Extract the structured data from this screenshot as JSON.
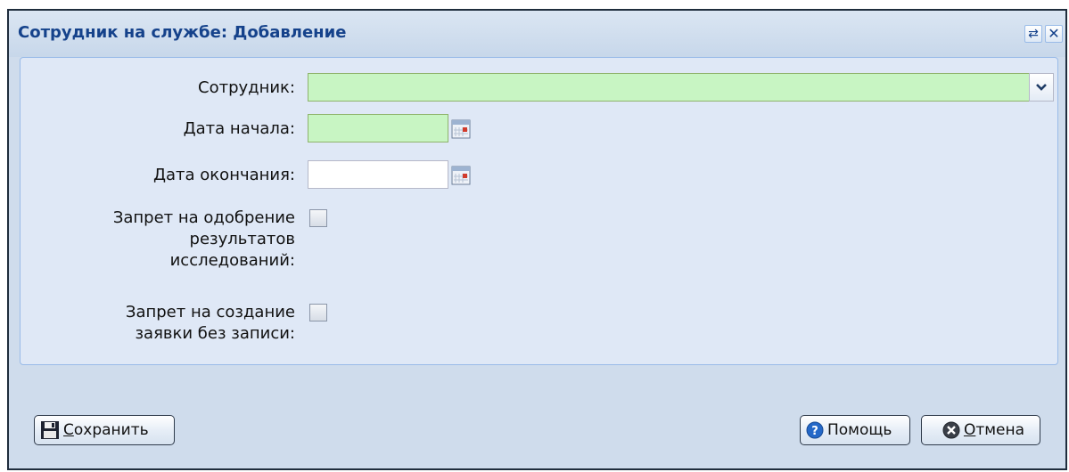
{
  "window": {
    "title": "Сотрудник на службе: Добавление",
    "restore_glyph": "⇄",
    "close_glyph": "✕"
  },
  "form": {
    "employee": {
      "label": "Сотрудник:",
      "value": ""
    },
    "start_date": {
      "label": "Дата начала:",
      "value": ""
    },
    "end_date": {
      "label": "Дата окончания:",
      "value": ""
    },
    "deny_approval": {
      "label_lines": [
        "Запрет на одобрение",
        "результатов",
        "исследований:"
      ],
      "checked": false
    },
    "deny_request": {
      "label_lines": [
        "Запрет на создание",
        "заявки без записи:"
      ],
      "checked": false
    }
  },
  "buttons": {
    "save": {
      "first": "С",
      "rest": "охранить"
    },
    "help": {
      "label": "Помощь"
    },
    "cancel": {
      "first": "О",
      "rest": "тмена"
    }
  },
  "colors": {
    "required_field": "#c8f5c3",
    "title_text": "#15428b",
    "window_bg": "#cfdcec"
  },
  "icons": [
    "refresh-icon",
    "close-icon",
    "chevron-down-icon",
    "calendar-icon",
    "save-disk-icon",
    "help-icon",
    "cancel-icon"
  ]
}
